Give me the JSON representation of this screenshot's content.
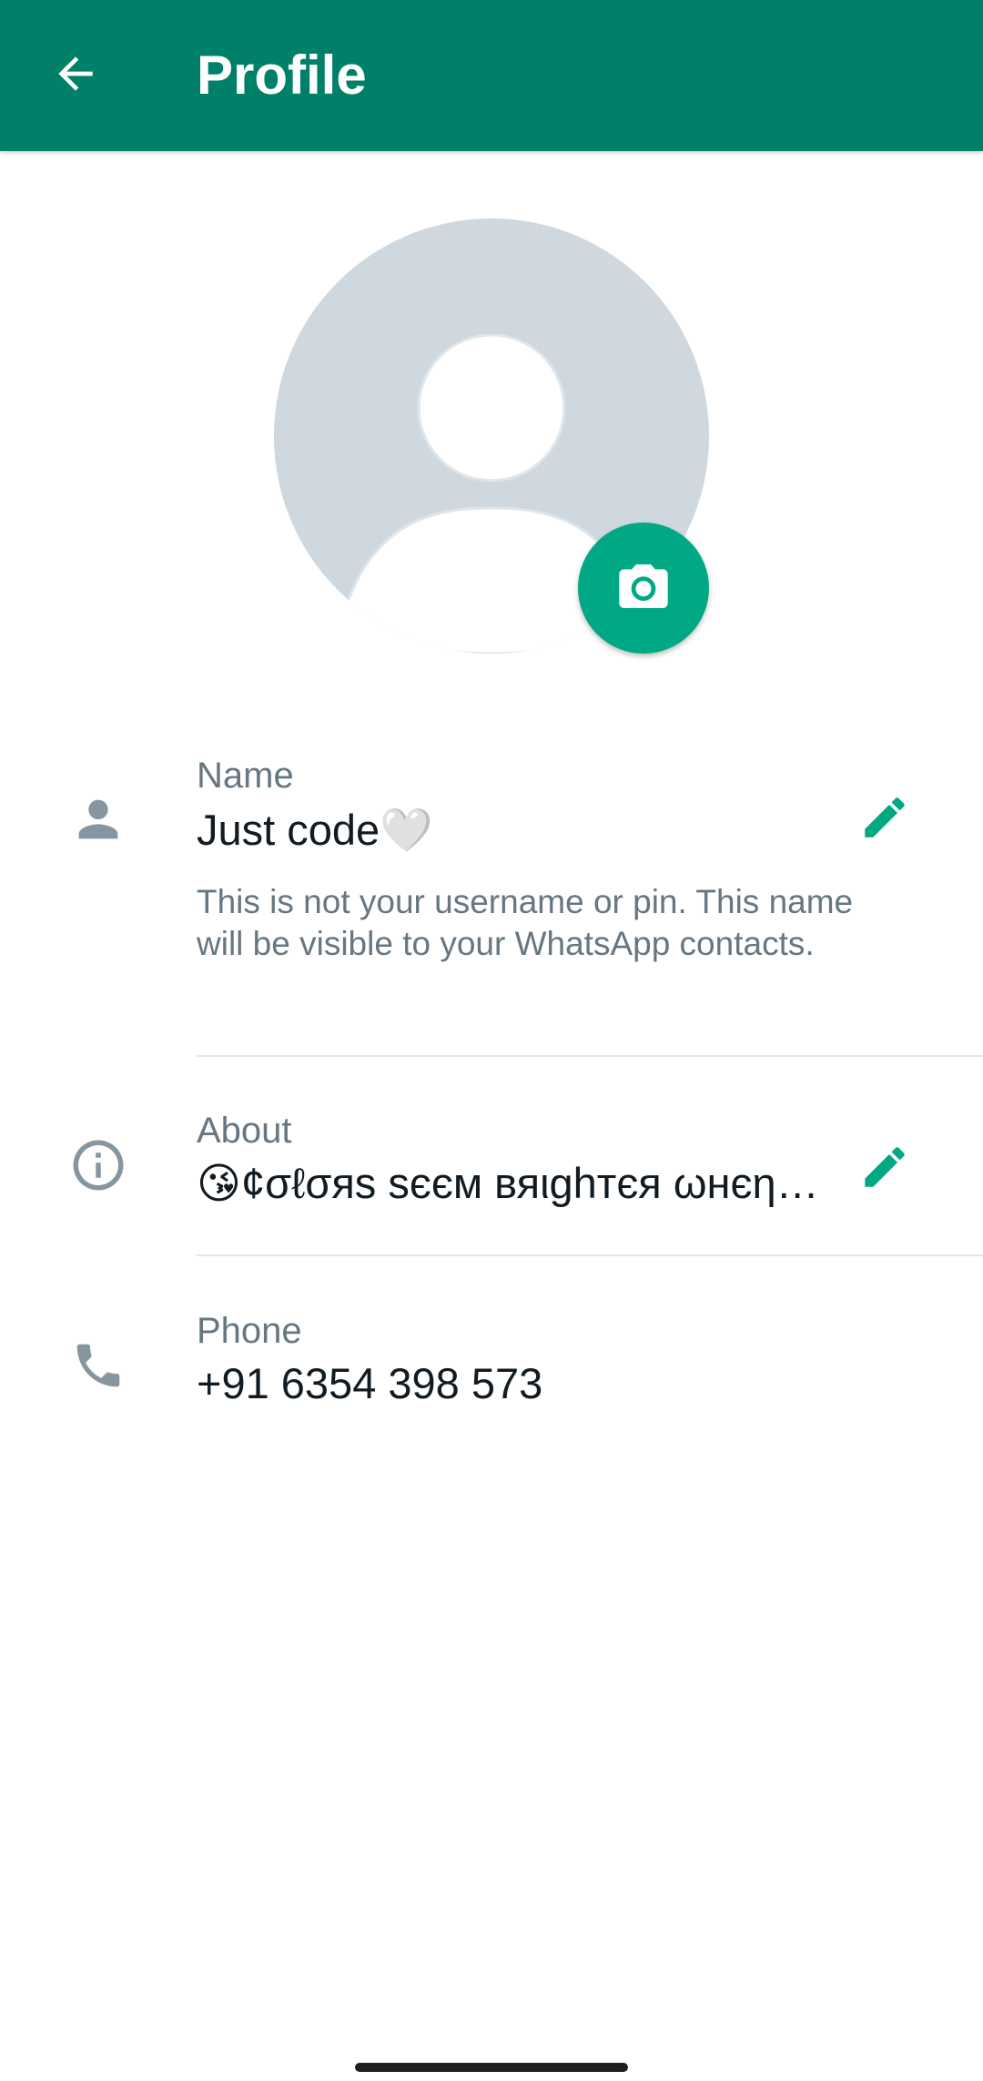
{
  "header": {
    "title": "Profile"
  },
  "profile": {
    "name_label": "Name",
    "name_value": "Just code🤍",
    "name_hint": "This is not your username or pin. This name will be visible to your WhatsApp contacts.",
    "about_label": "About",
    "about_value": "😘¢σℓσяѕ ѕєєм вяιghтєя ωнєη…",
    "phone_label": "Phone",
    "phone_value": "+91 6354 398 573"
  },
  "icons": {
    "back": "arrow-left-icon",
    "camera": "camera-icon",
    "person": "person-icon",
    "info": "info-icon",
    "phone": "phone-icon",
    "edit": "pencil-icon"
  },
  "colors": {
    "app_bar": "#008069",
    "accent": "#00a884",
    "secondary_text": "#667781",
    "primary_text": "#111b21",
    "icon_gray": "#8696a0",
    "avatar_bg": "#cfd8df"
  }
}
